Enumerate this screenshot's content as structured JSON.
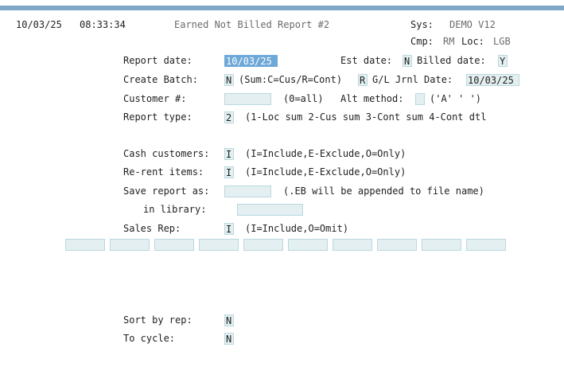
{
  "header": {
    "date": "10/03/25",
    "time": "08:33:34",
    "title": "Earned Not Billed Report #2",
    "sys_label": "Sys:",
    "sys_value": "DEMO V12",
    "cmp_label": "Cmp:",
    "cmp_value": "RM",
    "loc_label": "Loc:",
    "loc_value": "LGB"
  },
  "form": {
    "report_date": {
      "label": "Report date:",
      "value": "10/03/25"
    },
    "est_date": {
      "label": "Est date:",
      "value": "N"
    },
    "billed_date": {
      "label": "Billed date:",
      "value": "Y"
    },
    "create_batch": {
      "label": "Create Batch:",
      "value": "N",
      "hint": "(Sum:C=Cus/R=Cont)"
    },
    "sum_code": {
      "value": "R"
    },
    "gl_jrnl_date": {
      "label": "G/L Jrnl Date:",
      "value": "10/03/25"
    },
    "customer": {
      "label": "Customer #:",
      "value": "",
      "hint": "(0=all)"
    },
    "alt_method": {
      "label": "Alt method:",
      "value": "",
      "hint": "('A' ' ')"
    },
    "report_type": {
      "label": "Report type:",
      "value": "2",
      "hint": "(1-Loc sum 2-Cus sum 3-Cont sum 4-Cont dtl"
    },
    "cash_customers": {
      "label": "Cash customers:",
      "value": "I",
      "hint": "(I=Include,E-Exclude,O=Only)"
    },
    "rerent_items": {
      "label": "Re-rent items:",
      "value": "I",
      "hint": "(I=Include,E-Exclude,O=Only)"
    },
    "save_report": {
      "label": "Save report as:",
      "value": "",
      "hint": "(.EB will be appended to file name)"
    },
    "library": {
      "label": "in library:",
      "value": ""
    },
    "sales_rep": {
      "label": "Sales Rep:",
      "value": "I",
      "hint": "(I=Include,O=Omit)"
    },
    "rep_codes": [
      "",
      "",
      "",
      "",
      "",
      "",
      "",
      "",
      "",
      "",
      ""
    ],
    "sort_by_rep": {
      "label": "Sort by rep:",
      "value": "N"
    },
    "to_cycle": {
      "label": "To cycle:",
      "value": "N"
    }
  }
}
